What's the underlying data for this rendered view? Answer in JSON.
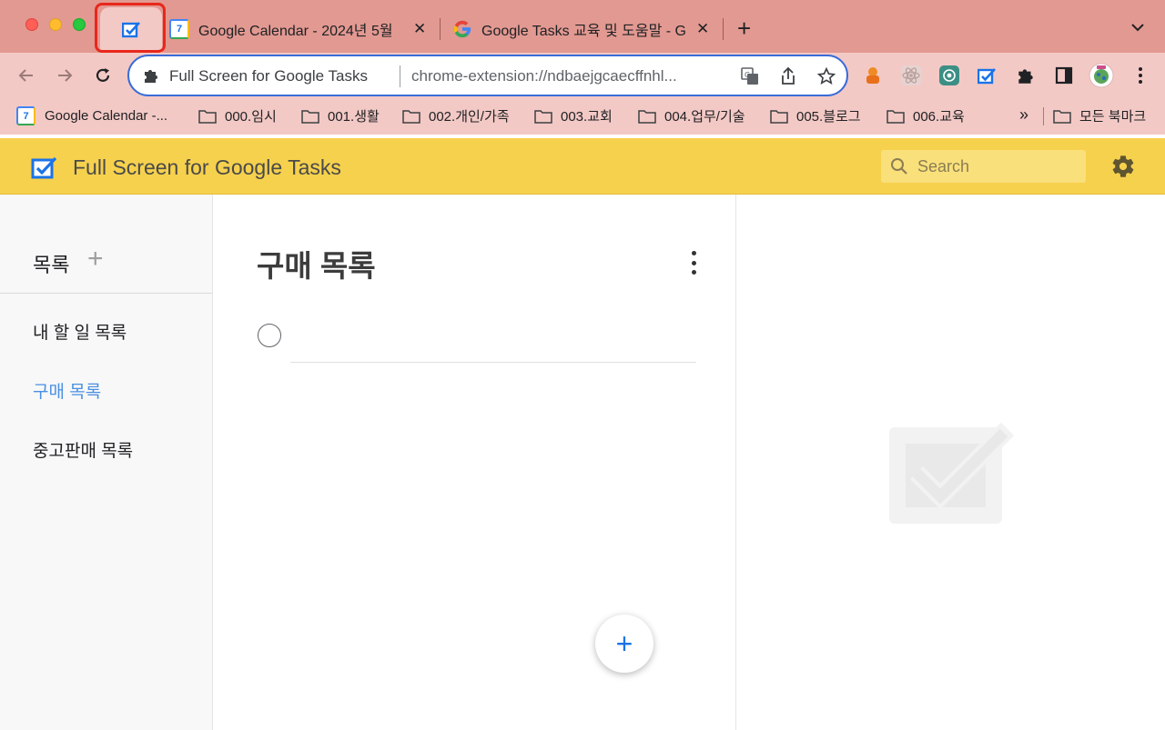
{
  "browser": {
    "tabs": [
      {
        "title": "Google Calendar - 2024년 5월",
        "icon": "google-calendar-icon"
      },
      {
        "title": "Google Tasks 교육 및 도움말 - G",
        "icon": "google-g-icon"
      }
    ],
    "active_tab_icon": "tasks-checkbox-icon",
    "calendar_badge": "7",
    "new_tab": "+",
    "close": "✕"
  },
  "omnibox": {
    "title": "Full Screen for Google Tasks",
    "url": "chrome-extension://ndbaejgcaecffnhl..."
  },
  "bookmarks": {
    "items": [
      {
        "label": "Google Calendar -..."
      },
      {
        "label": "000.임시"
      },
      {
        "label": "001.생활"
      },
      {
        "label": "002.개인/가족"
      },
      {
        "label": "003.교회"
      },
      {
        "label": "004.업무/기술"
      },
      {
        "label": "005.블로그"
      },
      {
        "label": "006.교육"
      }
    ],
    "more": "»",
    "all_bookmarks": "모든 북마크"
  },
  "app": {
    "title": "Full Screen for Google Tasks",
    "search_placeholder": "Search",
    "accent_color": "#f6d14d"
  },
  "sidebar": {
    "title": "목록",
    "add": "+",
    "items": [
      {
        "label": "내 할 일 목록",
        "active": false
      },
      {
        "label": "구매 목록",
        "active": true
      },
      {
        "label": "중고판매 목록",
        "active": false
      }
    ]
  },
  "list": {
    "title": "구매 목록",
    "new_task_value": "",
    "fab": "+"
  }
}
